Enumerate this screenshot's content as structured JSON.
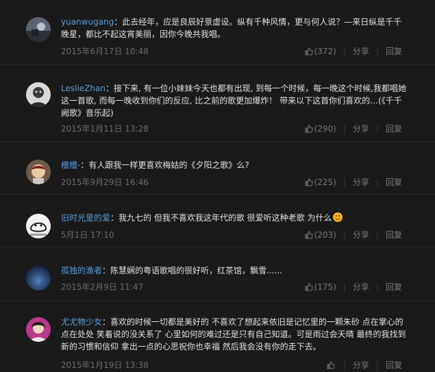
{
  "actions": {
    "share": "分享",
    "reply": "回复"
  },
  "comments": [
    {
      "user": "yuanwugang",
      "text": "此去经年，应是良辰好景虚设。纵有千种风情，更与何人说？—来日纵是千千晚星，都比不起这宵美丽，因你今晚共我唱。",
      "time": "2015年6月17日 10:48",
      "likes": "(372)"
    },
    {
      "user": "LeslieZhan",
      "text": "接下来, 有一位小妹妹今天也都有出现, 到每一个时候，每一晚这个时候,我都唱她这一首歌, 而每一晚收到你们的反应, 比之前的歌更加爆炸！ 带来以下这首你们喜欢的…(《千千阙歌》音乐起)",
      "time": "2015年1月11日 13:28",
      "likes": "(290)"
    },
    {
      "user": "檀檀-",
      "text": "有人跟我一样更喜欢梅姑的《夕阳之歌》么?",
      "time": "2015年9月29日 16:46",
      "likes": "(225)"
    },
    {
      "user": "旧时光里的爱",
      "text": "我九七的 但我不喜欢我这年代的歌 很爱听这种老歌 为什么",
      "time": "5月1日 17:10",
      "likes": "(203)"
    },
    {
      "user": "孤独的渔者",
      "text": "陈慧娴的粤语歌唱的很好听，红茶馆，飘雪......",
      "time": "2015年2月9日 11:47",
      "likes": "(175)"
    },
    {
      "user": "尤尤物少女",
      "text": "喜欢的时候一切都是美好的 不喜欢了想起来依旧是记忆里的一颗朱砂 点在掌心的点在处处 笑着说的没关系了 心里如何的难过还是只有自己知道。可是雨过会天晴 最终的我找到新的习惯和信仰 拿出一点的心思祝你也幸福 然后我会没有你的走下去。",
      "time": "2015年1月19日 13:38",
      "likes": ""
    }
  ],
  "colors": {
    "username": "#5a9bd5",
    "background": "#1a1a1a",
    "meta": "#6a6a6a"
  }
}
